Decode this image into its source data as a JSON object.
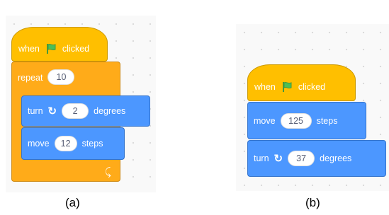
{
  "header_text": "",
  "panel_a": {
    "hat": {
      "when": "when",
      "flag_icon": "green-flag",
      "clicked": "clicked"
    },
    "repeat": {
      "label": "repeat",
      "value": "10"
    },
    "turn": {
      "label": "turn",
      "rotate_icon": "rotate-clockwise",
      "value": "2",
      "unit": "degrees"
    },
    "move": {
      "label": "move",
      "value": "12",
      "unit": "steps"
    },
    "loop_icon": "loop-arrow",
    "caption": "(a)"
  },
  "panel_b": {
    "hat": {
      "when": "when",
      "flag_icon": "green-flag",
      "clicked": "clicked"
    },
    "move": {
      "label": "move",
      "value": "125",
      "unit": "steps"
    },
    "turn": {
      "label": "turn",
      "rotate_icon": "rotate-clockwise",
      "value": "37",
      "unit": "degrees"
    },
    "caption": "(b)"
  },
  "colors": {
    "events": "#ffbf00",
    "control": "#ffab19",
    "motion": "#4c97ff",
    "flag_green": "#4cbf56"
  }
}
